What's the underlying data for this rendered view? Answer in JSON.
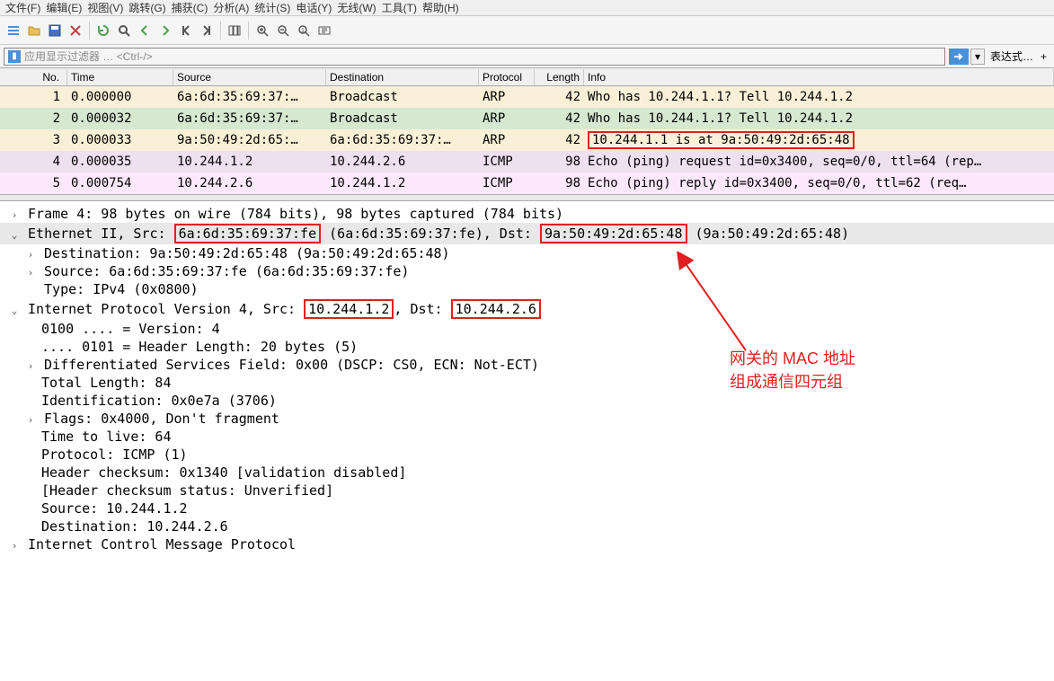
{
  "menu": {
    "items": [
      "文件(F)",
      "编辑(E)",
      "视图(V)",
      "跳转(G)",
      "捕获(C)",
      "分析(A)",
      "统计(S)",
      "电话(Y)",
      "无线(W)",
      "工具(T)",
      "帮助(H)"
    ]
  },
  "toolbar": {
    "icons": [
      "menu-icon",
      "folder-open-icon",
      "save-icon",
      "close-icon",
      "reload-icon",
      "find-icon",
      "arrow-left-icon",
      "arrow-right-icon",
      "skip-left-icon",
      "skip-right-icon",
      "columns-icon",
      "zoom-in-icon",
      "zoom-out-icon",
      "zoom-reset-icon",
      "resize-icon"
    ]
  },
  "filter": {
    "placeholder": "应用显示过滤器 … <Ctrl-/>",
    "expr_label": "表达式…",
    "plus": "+"
  },
  "columns": {
    "no": "No.",
    "time": "Time",
    "source": "Source",
    "destination": "Destination",
    "protocol": "Protocol",
    "length": "Length",
    "info": "Info"
  },
  "packets": [
    {
      "no": "1",
      "time": "0.000000",
      "src": "6a:6d:35:69:37:…",
      "dst": "Broadcast",
      "proto": "ARP",
      "len": "42",
      "info": "Who has 10.244.1.1? Tell 10.244.1.2",
      "cls": "row-arp-light"
    },
    {
      "no": "2",
      "time": "0.000032",
      "src": "6a:6d:35:69:37:…",
      "dst": "Broadcast",
      "proto": "ARP",
      "len": "42",
      "info": "Who has 10.244.1.1? Tell 10.244.1.2",
      "cls": "row-arp-sel"
    },
    {
      "no": "3",
      "time": "0.000033",
      "src": "9a:50:49:2d:65:…",
      "dst": "6a:6d:35:69:37:…",
      "proto": "ARP",
      "len": "42",
      "info": "10.244.1.1 is at 9a:50:49:2d:65:48",
      "cls": "row-arp-light",
      "boxinfo": true
    },
    {
      "no": "4",
      "time": "0.000035",
      "src": "10.244.1.2",
      "dst": "10.244.2.6",
      "proto": "ICMP",
      "len": "98",
      "info": "Echo (ping) request  id=0x3400, seq=0/0, ttl=64 (rep…",
      "cls": "row-icmp"
    },
    {
      "no": "5",
      "time": "0.000754",
      "src": "10.244.2.6",
      "dst": "10.244.1.2",
      "proto": "ICMP",
      "len": "98",
      "info": "Echo (ping) reply    id=0x3400, seq=0/0, ttl=62 (req…",
      "cls": "row-icmp-light"
    }
  ],
  "details": {
    "frame": "Frame 4: 98 bytes on wire (784 bits), 98 bytes captured (784 bits)",
    "eth_prefix": "Ethernet II, Src: ",
    "eth_src_mac": "6a:6d:35:69:37:fe",
    "eth_mid": " (6a:6d:35:69:37:fe), Dst: ",
    "eth_dst_mac": "9a:50:49:2d:65:48",
    "eth_suffix": " (9a:50:49:2d:65:48)",
    "eth_dest": "Destination: 9a:50:49:2d:65:48 (9a:50:49:2d:65:48)",
    "eth_source": "Source: 6a:6d:35:69:37:fe (6a:6d:35:69:37:fe)",
    "eth_type": "Type: IPv4 (0x0800)",
    "ip_prefix": "Internet Protocol Version 4, Src: ",
    "ip_src": "10.244.1.2",
    "ip_mid": ", Dst: ",
    "ip_dst": "10.244.2.6",
    "ip_version": "0100 .... = Version: 4",
    "ip_hlen": ".... 0101 = Header Length: 20 bytes (5)",
    "ip_ds": "Differentiated Services Field: 0x00 (DSCP: CS0, ECN: Not-ECT)",
    "ip_totlen": "Total Length: 84",
    "ip_id": "Identification: 0x0e7a (3706)",
    "ip_flags": "Flags: 0x4000, Don't fragment",
    "ip_ttl": "Time to live: 64",
    "ip_proto": "Protocol: ICMP (1)",
    "ip_cksum": "Header checksum: 0x1340 [validation disabled]",
    "ip_cksum_status": "[Header checksum status: Unverified]",
    "ip_srcline": "Source: 10.244.1.2",
    "ip_dstline": "Destination: 10.244.2.6",
    "icmp": "Internet Control Message Protocol"
  },
  "annotation": {
    "line1": "网关的 MAC 地址",
    "line2": "组成通信四元组"
  }
}
